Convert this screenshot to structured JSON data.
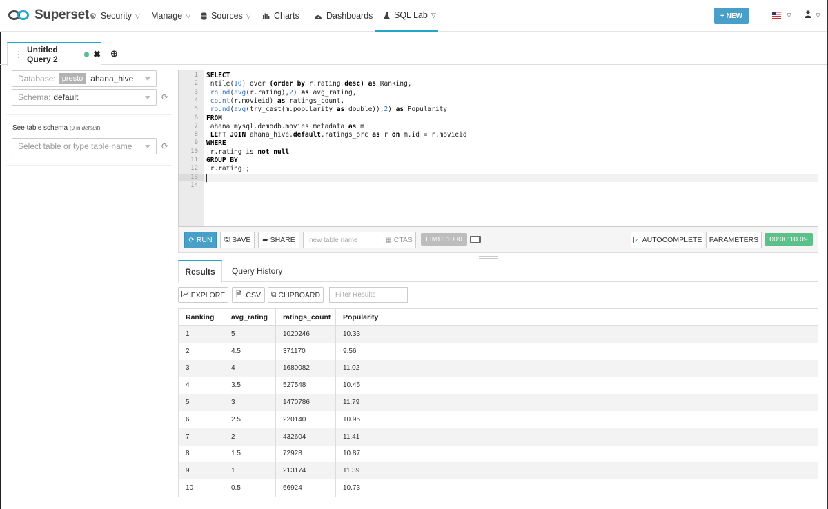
{
  "brand": {
    "name": "Superset"
  },
  "nav": {
    "items": [
      {
        "label": "Security",
        "icon": "gear-icon",
        "has_caret": true
      },
      {
        "label": "Manage",
        "icon": "",
        "has_caret": true
      },
      {
        "label": "Sources",
        "icon": "database-icon",
        "has_caret": true
      },
      {
        "label": "Charts",
        "icon": "bar-chart-icon",
        "has_caret": false
      },
      {
        "label": "Dashboards",
        "icon": "dashboard-icon",
        "has_caret": false
      },
      {
        "label": "SQL Lab",
        "icon": "flask-icon",
        "has_caret": true
      }
    ],
    "new_label": "+ NEW"
  },
  "query_tab": {
    "title": "Untitled Query 2",
    "status_color": "#5ac189"
  },
  "left": {
    "database_label": "Database:",
    "database_engine": "presto",
    "database_value": "ahana_hive",
    "schema_label": "Schema:",
    "schema_value": "default",
    "table_schema_title": "See table schema",
    "table_schema_count_prefix": "(0 in ",
    "table_schema_count_schema": "default",
    "table_schema_count_suffix": ")",
    "table_select_placeholder": "Select table or type table name"
  },
  "editor": {
    "line_numbers": [
      "1",
      "2",
      "3",
      "4",
      "5",
      "6",
      "7",
      "8",
      "9",
      "10",
      "11",
      "12",
      "13",
      "14"
    ]
  },
  "toolbar": {
    "run": "RUN",
    "save": "SAVE",
    "share": "SHARE",
    "table_name_placeholder": "new table name",
    "ctas": "CTAS",
    "limit": "LIMIT 1000",
    "autocomplete": "AUTOCOMPLETE",
    "parameters": "PARAMETERS",
    "timer": "00:00:10.09"
  },
  "results": {
    "tabs": [
      "Results",
      "Query History"
    ],
    "explore": "EXPLORE",
    "csv": ".CSV",
    "clipboard": "CLIPBOARD",
    "filter_placeholder": "Filter Results",
    "columns": [
      "Ranking",
      "avg_rating",
      "ratings_count",
      "Popularity"
    ],
    "rows": [
      [
        "1",
        "5",
        "1020246",
        "10.33"
      ],
      [
        "2",
        "4.5",
        "371170",
        "9.56"
      ],
      [
        "3",
        "4",
        "1680082",
        "11.02"
      ],
      [
        "4",
        "3.5",
        "527548",
        "10.45"
      ],
      [
        "5",
        "3",
        "1470786",
        "11.79"
      ],
      [
        "6",
        "2.5",
        "220140",
        "10.95"
      ],
      [
        "7",
        "2",
        "432604",
        "11.41"
      ],
      [
        "8",
        "1.5",
        "72928",
        "10.87"
      ],
      [
        "9",
        "1",
        "213174",
        "11.39"
      ],
      [
        "10",
        "0.5",
        "66924",
        "10.73"
      ]
    ]
  },
  "colors": {
    "accent": "#20a7c9",
    "run_button": "#48a0c8",
    "success": "#5ac189"
  }
}
